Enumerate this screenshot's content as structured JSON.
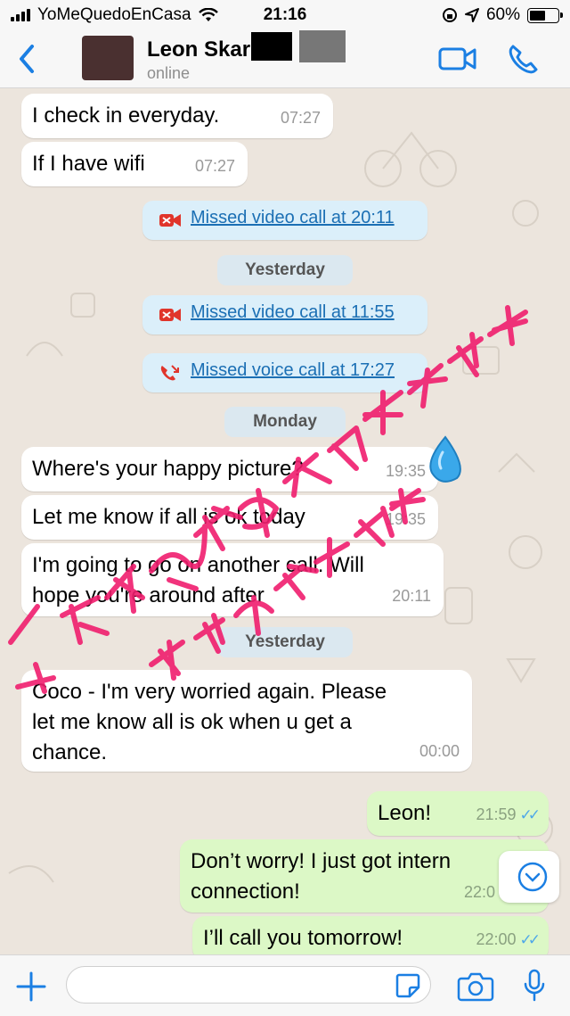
{
  "status_bar": {
    "carrier": "YoMeQuedoEnCasa",
    "time": "21:16",
    "battery": "60%",
    "battery_level": 0.6
  },
  "header": {
    "name": "Leon Skar",
    "status": "online"
  },
  "messages": [
    {
      "kind": "in",
      "text": "I check in everyday.",
      "time": "07:27"
    },
    {
      "kind": "in",
      "text": "If I have wifi",
      "time": "07:27"
    },
    {
      "kind": "system",
      "icon": "missed-video-call-icon",
      "text": "Missed video call at 20:11"
    },
    {
      "kind": "day",
      "text": "Yesterday"
    },
    {
      "kind": "system",
      "icon": "missed-video-call-icon",
      "text": "Missed video call at 11:55"
    },
    {
      "kind": "system",
      "icon": "missed-voice-call-icon",
      "text": "Missed voice call at 17:27"
    },
    {
      "kind": "day",
      "text": "Monday"
    },
    {
      "kind": "in",
      "text": "Where's your happy picture?",
      "time": "19:35"
    },
    {
      "kind": "in",
      "text": "Let me know if all is ok today",
      "time": "19:35"
    },
    {
      "kind": "in",
      "text": "I'm going to go on another call. Will\nhope you're around after",
      "time": "20:11"
    },
    {
      "kind": "day",
      "text": "Yesterday"
    },
    {
      "kind": "in",
      "text": "Coco - I'm very worried again.  Please\nlet me know all is ok when u get a\nchance.",
      "time": "00:00"
    },
    {
      "kind": "out",
      "text": "Leon!",
      "time": "21:59"
    },
    {
      "kind": "out",
      "text": "Don’t worry! I just got intern\nconnection!",
      "time": "22:0"
    },
    {
      "kind": "out",
      "text": "I’ll call you tomorrow!",
      "time": "22:00"
    }
  ],
  "input": {
    "placeholder": ""
  },
  "colors": {
    "accent": "#1b7fe3",
    "outgoing_bubble": "#dcf8c6",
    "incoming_bubble": "#ffffff",
    "system_bubble": "#dbeffa",
    "missed_call_red": "#e0352b",
    "overlay_text": "#f01e6e"
  },
  "overlay": {
    "watermark_text": "从不缺情的爱情天天在我面前撩起泪花"
  }
}
